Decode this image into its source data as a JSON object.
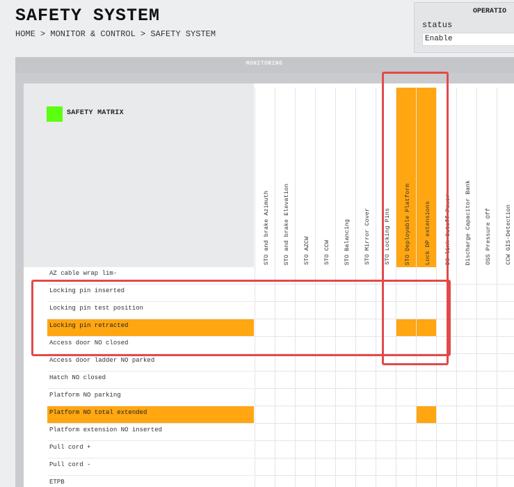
{
  "page": {
    "title": "SAFETY SYSTEM",
    "breadcrumb": "HOME > MONITOR & CONTROL > SAFETY SYSTEM"
  },
  "operation": {
    "title": "OPERATIO",
    "status_label": "status",
    "status_value": "Enable"
  },
  "monitoring": {
    "header": "MONITORING",
    "matrix_title": "SAFETY MATRIX",
    "legend_color": "#5bff10",
    "highlight_color": "#ffa611",
    "annotation_color": "#e24a4a",
    "columns": [
      {
        "label": "STO and brake Azimuth",
        "highlight": false
      },
      {
        "label": "STO and brake Elevation",
        "highlight": false
      },
      {
        "label": "STO AZCW",
        "highlight": false
      },
      {
        "label": "STO CCW",
        "highlight": false
      },
      {
        "label": "STO Balancing",
        "highlight": false
      },
      {
        "label": "STO Mirror Cover",
        "highlight": false
      },
      {
        "label": "STO Locking Pins",
        "highlight": false
      },
      {
        "label": "STO Deployable Platform",
        "highlight": true
      },
      {
        "label": "Lock DP extensions",
        "highlight": true
      },
      {
        "label": "DC-link Cutoff Power",
        "highlight": false
      },
      {
        "label": "Discharge Capacitor Bank",
        "highlight": false
      },
      {
        "label": "OSS Pressure Off",
        "highlight": false
      },
      {
        "label": "CCW GIS-Detection",
        "highlight": false
      }
    ],
    "rows": [
      {
        "label": "AZ cable wrap lim-",
        "highlight": false,
        "active_cols": []
      },
      {
        "label": "Locking pin inserted",
        "highlight": false,
        "active_cols": []
      },
      {
        "label": "Locking pin test position",
        "highlight": false,
        "active_cols": []
      },
      {
        "label": "Locking pin retracted",
        "highlight": true,
        "active_cols": [
          7,
          8
        ]
      },
      {
        "label": "Access door NO closed",
        "highlight": false,
        "active_cols": []
      },
      {
        "label": "Access door ladder NO parked",
        "highlight": false,
        "active_cols": []
      },
      {
        "label": "Hatch NO closed",
        "highlight": false,
        "active_cols": []
      },
      {
        "label": "Platform NO parking",
        "highlight": false,
        "active_cols": []
      },
      {
        "label": "Platform NO total extended",
        "highlight": true,
        "active_cols": [
          8
        ]
      },
      {
        "label": "Platform extension NO inserted",
        "highlight": false,
        "active_cols": []
      },
      {
        "label": "Pull cord +",
        "highlight": false,
        "active_cols": []
      },
      {
        "label": "Pull cord -",
        "highlight": false,
        "active_cols": []
      },
      {
        "label": "ETPB",
        "highlight": false,
        "active_cols": []
      }
    ]
  }
}
